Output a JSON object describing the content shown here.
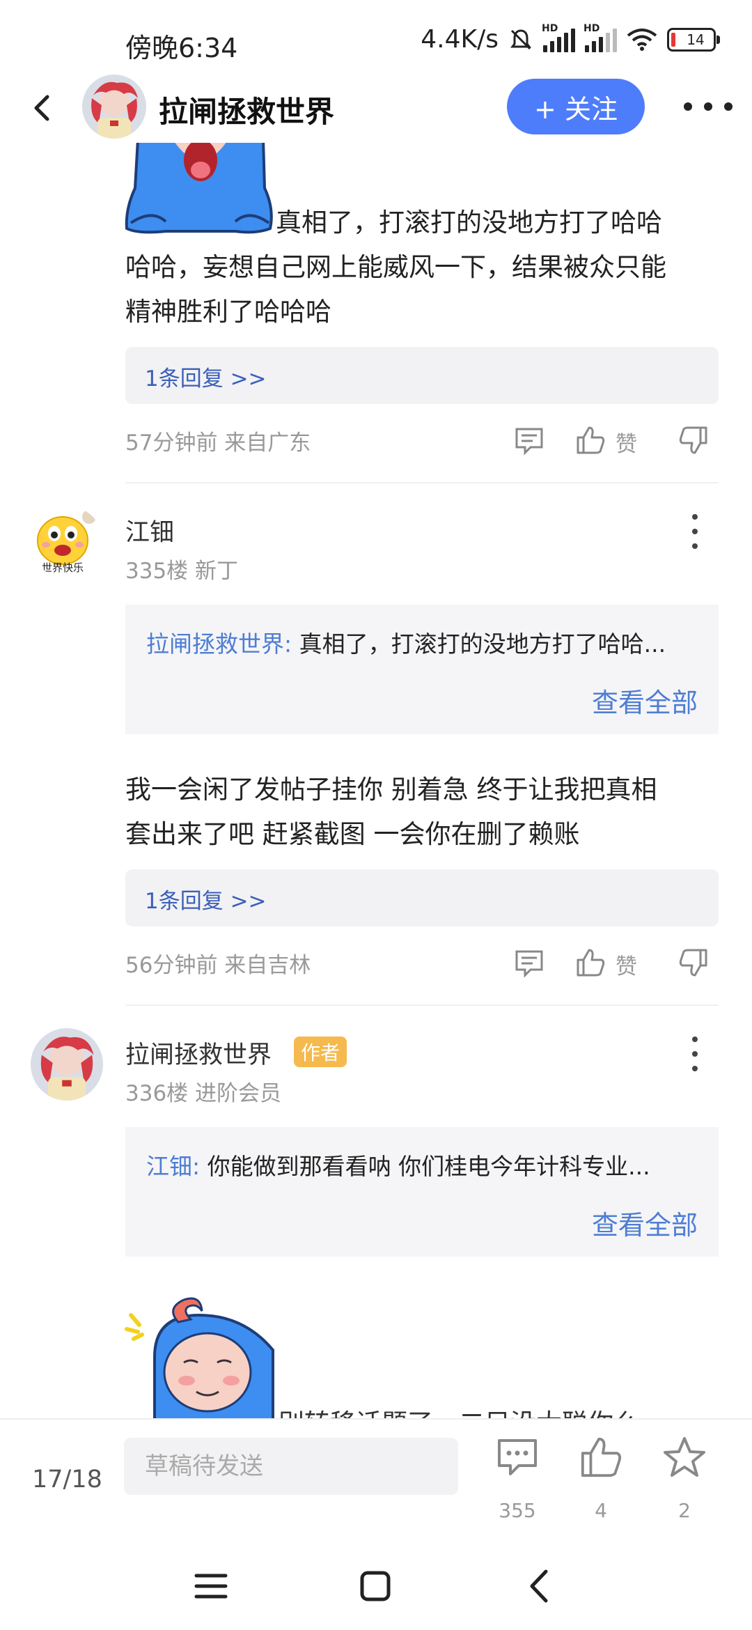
{
  "status_bar": {
    "time": "傍晚6:34",
    "network_speed": "4.4K/s",
    "hd_label": "HD",
    "battery_level": "14",
    "icons": [
      "mute-icon",
      "signal-icon",
      "signal-icon",
      "wifi-icon",
      "battery-icon"
    ]
  },
  "header": {
    "title": "拉闸拯救世界",
    "follow_label": "+ 关注"
  },
  "thread": {
    "top_post": {
      "text_first_line": "真相了，打滚打的没地方打了哈哈",
      "text_line_2": "哈哈，妄想自己网上能威风一下，结果被众只能",
      "text_line_3": "精神胜利了哈哈哈",
      "reply_link": "1条回复 >>",
      "meta": "57分钟前 来自广东",
      "like_label": "赞"
    },
    "floor_335": {
      "username": "江钿",
      "floor_info": "335楼 新丁",
      "quote_name": "拉闸拯救世界:",
      "quote_text": " 真相了，打滚打的没地方打了哈哈...",
      "view_all": "查看全部",
      "text_line_1": "我一会闲了发帖子挂你 别着急 终于让我把真相",
      "text_line_2": "套出来了吧 赶紧截图 一会你在删了赖账",
      "reply_link": "1条回复 >>",
      "meta": "56分钟前 来自吉林",
      "like_label": "赞",
      "avatar_caption": "世界快乐"
    },
    "floor_336": {
      "username": "拉闸拯救世界",
      "author_badge": "作者",
      "floor_info": "336楼 进阶会员",
      "quote_name": "江钿:",
      "quote_text": " 你能做到那看看呐 你们桂电今年计科专业...",
      "view_all": "查看全部",
      "partial_text": "别转移话题了，二目没太聪你么"
    }
  },
  "bottom_bar": {
    "page_indicator": "17/18",
    "draft_placeholder": "草稿待发送",
    "comment_count": "355",
    "like_count": "4",
    "star_count": "2"
  },
  "colors": {
    "accent": "#4e7dfb",
    "link": "#4e7dd3",
    "reply_link": "#3c5fb8",
    "author_badge": "#f5b94d"
  }
}
